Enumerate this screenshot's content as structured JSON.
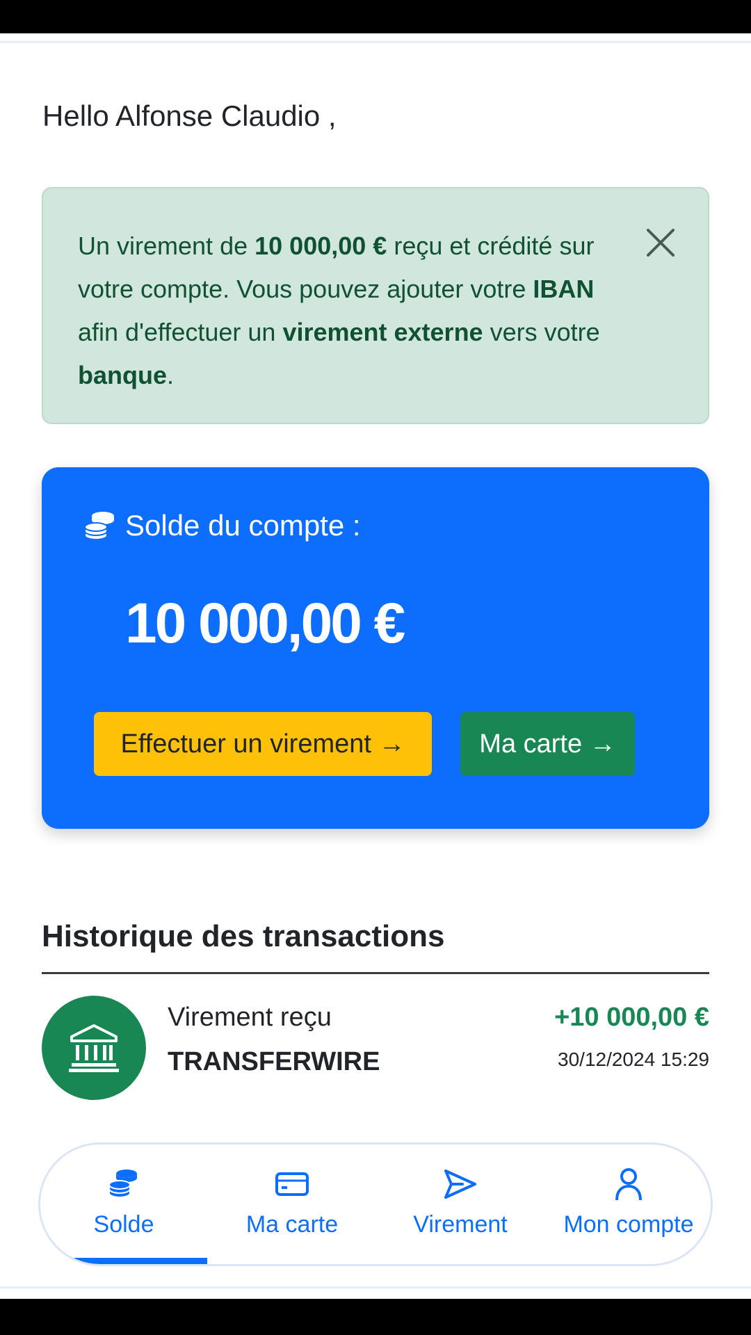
{
  "greeting": "Hello Alfonse Claudio ,",
  "alert": {
    "part1": "Un virement de",
    "amount": "10 000,00 €",
    "part2": "reçu et crédité sur votre compte. Vous pouvez ajouter votre",
    "iban": "IBAN",
    "part3": "afin d'effectuer un",
    "external": "virement externe",
    "part4": "vers votre",
    "bank": "banque",
    "part5": "."
  },
  "balance": {
    "label": "Solde du compte :",
    "amount": "10 000,00 €",
    "transfer_button": "Effectuer un virement →",
    "card_button": "Ma carte →"
  },
  "history": {
    "title": "Historique des transactions",
    "transactions": [
      {
        "type": "Virement reçu",
        "name": "TRANSFERWIRE",
        "amount": "+10 000,00 €",
        "date": "30/12/2024 15:29"
      }
    ]
  },
  "nav": {
    "items": [
      {
        "label": "Solde",
        "icon": "coins-icon"
      },
      {
        "label": "Ma carte",
        "icon": "credit-card-icon"
      },
      {
        "label": "Virement",
        "icon": "send-icon"
      },
      {
        "label": "Mon compte",
        "icon": "person-icon"
      }
    ],
    "active": "Solde"
  },
  "colors": {
    "primary": "#0d6efd",
    "success": "#198754",
    "warning": "#ffc107",
    "alert_bg": "#d1e7dd",
    "alert_text": "#0f5132"
  }
}
